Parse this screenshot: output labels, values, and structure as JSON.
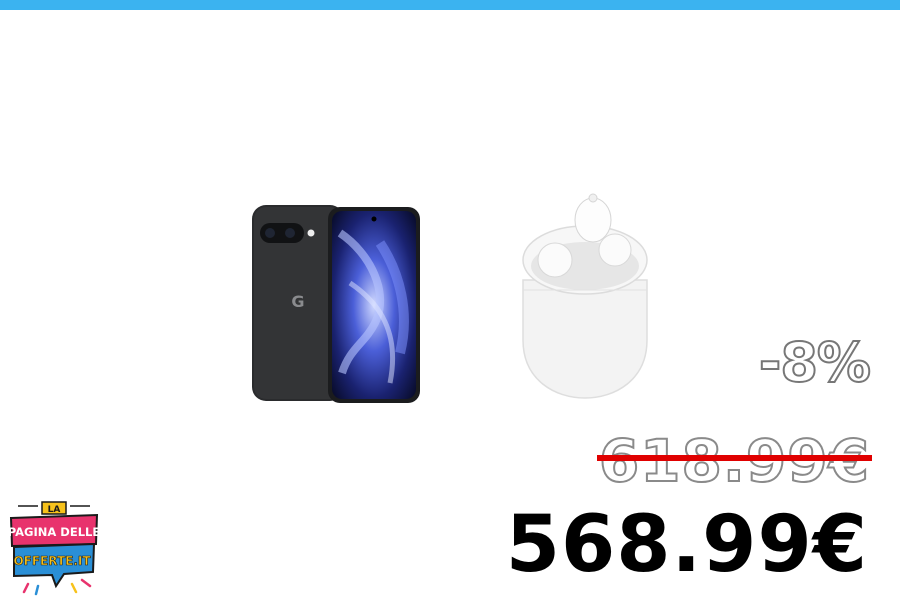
{
  "colors": {
    "top_bar": "#3bb3f0",
    "strike": "#e00000",
    "logo_pink": "#e8336d",
    "logo_blue": "#2a8fd6",
    "logo_yellow": "#f7c21b"
  },
  "products": {
    "phone": {
      "icon": "smartphone-image",
      "brand_mark": "G"
    },
    "earbuds": {
      "icon": "earbuds-case-image"
    }
  },
  "pricing": {
    "discount": "-8%",
    "old_price": "618.99€",
    "new_price": "568.99€"
  },
  "logo": {
    "line1": "LA",
    "line2": "PAGINA DELLE",
    "line3": "OFFERTE.IT"
  }
}
